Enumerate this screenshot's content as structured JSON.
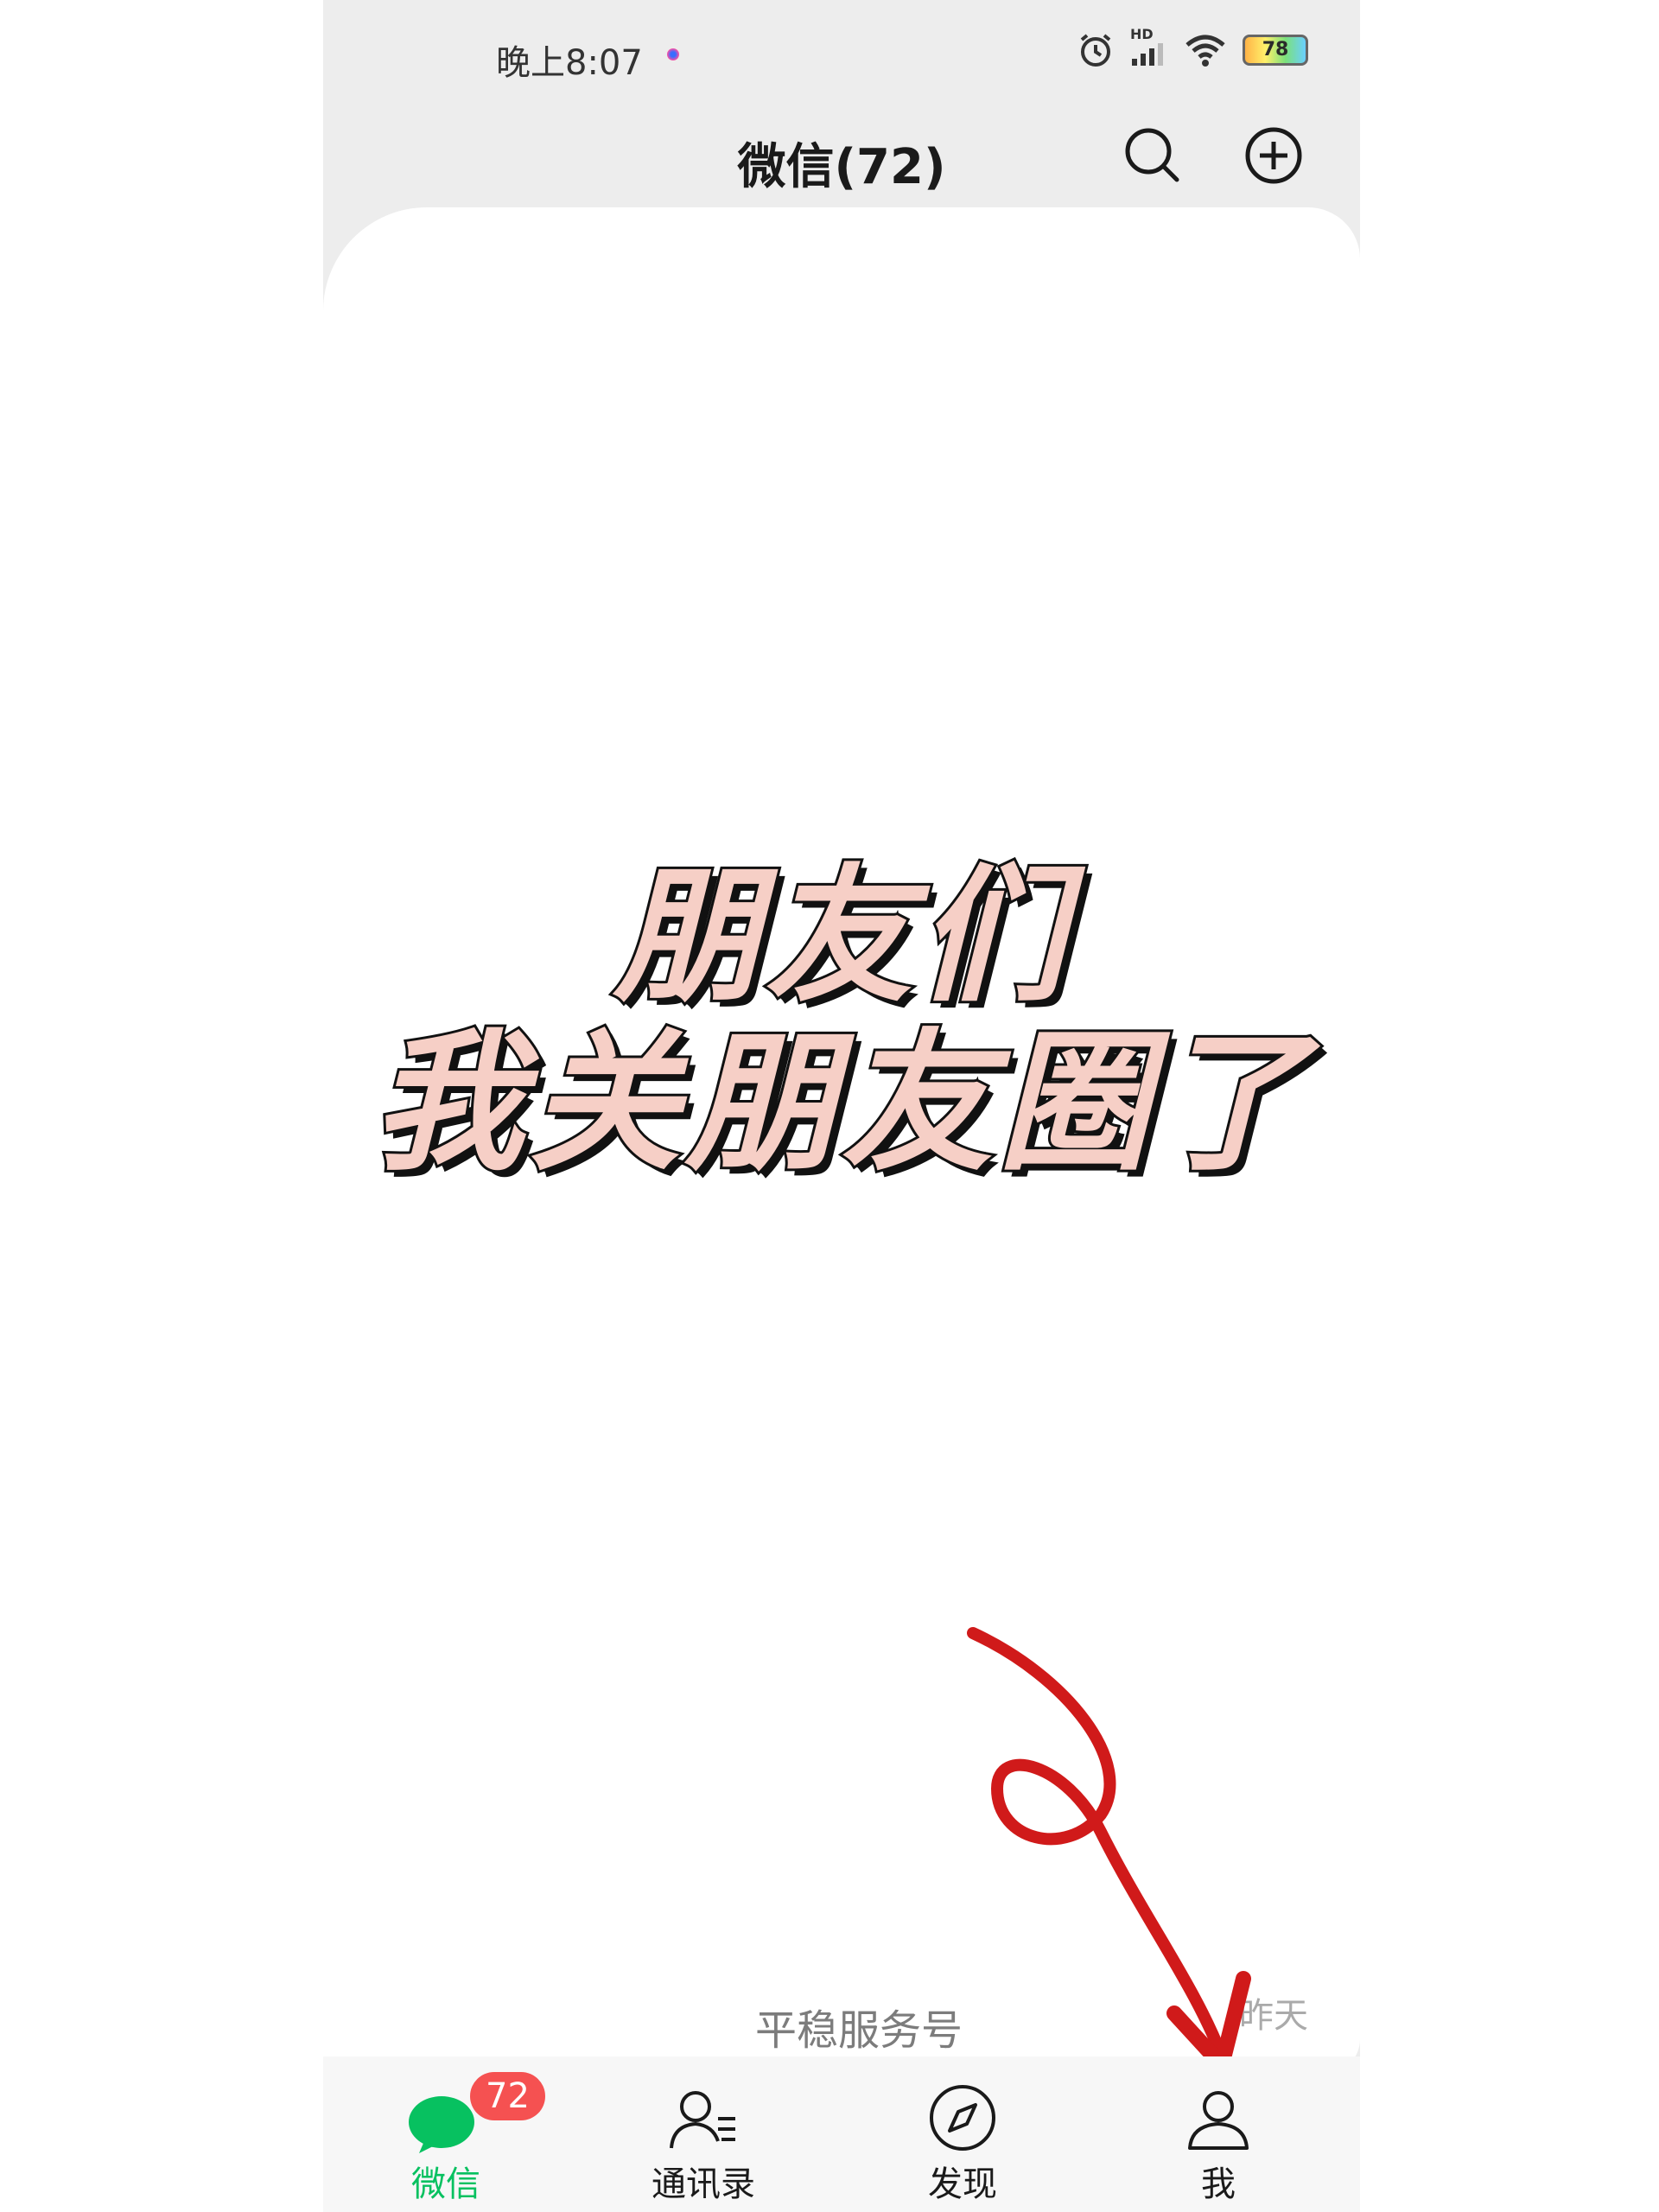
{
  "status_bar": {
    "time": "晚上8:07",
    "network_label": "HD",
    "battery_level": "78",
    "icons": [
      "alarm-icon",
      "signal-icon",
      "wifi-icon",
      "battery-icon"
    ]
  },
  "header": {
    "title": "微信(72)",
    "search_icon": "search-icon",
    "add_icon": "plus-circle-icon"
  },
  "overlay": {
    "line1": "朋友们",
    "line2": "我关朋友圈了",
    "text_color": "#f6cfc6",
    "arrow_color": "#d01a1a"
  },
  "background_fragments": {
    "row_text": "平稳服务号",
    "time_text": "昨天"
  },
  "tabbar": {
    "accent": "#07c160",
    "tabs": [
      {
        "label": "微信",
        "icon": "chat-bubble-icon",
        "badge": "72",
        "active": true
      },
      {
        "label": "通讯录",
        "icon": "contacts-icon",
        "active": false
      },
      {
        "label": "发现",
        "icon": "compass-icon",
        "active": false
      },
      {
        "label": "我",
        "icon": "person-icon",
        "active": false
      }
    ]
  }
}
